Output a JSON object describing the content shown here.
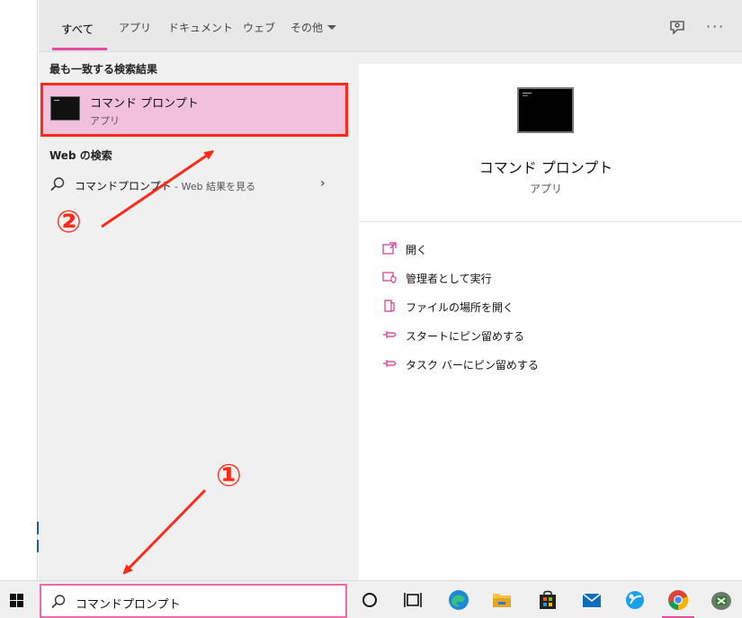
{
  "tabs": {
    "all": "すべて",
    "apps": "アプリ",
    "documents": "ドキュメント",
    "web": "ウェブ",
    "more": "その他"
  },
  "header_more": "···",
  "results": {
    "best_match_title": "最も一致する検索結果",
    "best_match": {
      "name": "コマンド プロンプト",
      "type": "アプリ"
    },
    "web_section_title": "Web の検索",
    "web_item": {
      "query": "コマンドプロンプト",
      "suffix": " - Web 結果を見る"
    }
  },
  "detail": {
    "name": "コマンド プロンプト",
    "type": "アプリ",
    "actions": [
      {
        "label": "開く",
        "icon": "open-icon"
      },
      {
        "label": "管理者として実行",
        "icon": "run-as-admin-icon"
      },
      {
        "label": "ファイルの場所を開く",
        "icon": "file-location-icon"
      },
      {
        "label": "スタートにピン留めする",
        "icon": "pin-icon"
      },
      {
        "label": "タスク バーにピン留めする",
        "icon": "pin-icon"
      }
    ]
  },
  "taskbar": {
    "search_value": "コマンドプロンプト",
    "icons": [
      "windows-start-icon",
      "cortana-icon",
      "task-view-icon",
      "edge-icon",
      "file-explorer-icon",
      "store-icon",
      "mail-icon",
      "app-icon",
      "chrome-icon",
      "excel-app-icon"
    ]
  },
  "annotations": {
    "step1": "①",
    "step2": "②"
  },
  "colors": {
    "accent": "#e04ca0",
    "annotation_red": "#ff2a1a",
    "highlight_bg": "#f2c0dc"
  }
}
